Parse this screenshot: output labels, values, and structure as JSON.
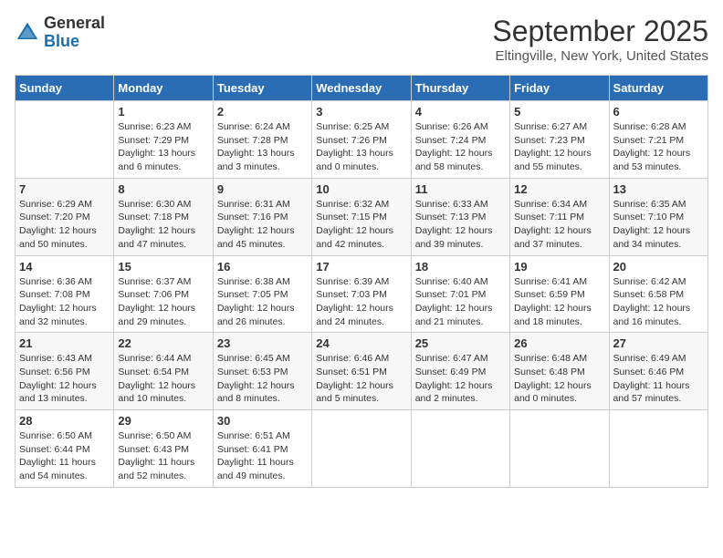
{
  "header": {
    "logo_general": "General",
    "logo_blue": "Blue",
    "month_title": "September 2025",
    "subtitle": "Eltingville, New York, United States"
  },
  "days_of_week": [
    "Sunday",
    "Monday",
    "Tuesday",
    "Wednesday",
    "Thursday",
    "Friday",
    "Saturday"
  ],
  "weeks": [
    [
      {
        "day": "",
        "text": ""
      },
      {
        "day": "1",
        "text": "Sunrise: 6:23 AM\nSunset: 7:29 PM\nDaylight: 13 hours\nand 6 minutes."
      },
      {
        "day": "2",
        "text": "Sunrise: 6:24 AM\nSunset: 7:28 PM\nDaylight: 13 hours\nand 3 minutes."
      },
      {
        "day": "3",
        "text": "Sunrise: 6:25 AM\nSunset: 7:26 PM\nDaylight: 13 hours\nand 0 minutes."
      },
      {
        "day": "4",
        "text": "Sunrise: 6:26 AM\nSunset: 7:24 PM\nDaylight: 12 hours\nand 58 minutes."
      },
      {
        "day": "5",
        "text": "Sunrise: 6:27 AM\nSunset: 7:23 PM\nDaylight: 12 hours\nand 55 minutes."
      },
      {
        "day": "6",
        "text": "Sunrise: 6:28 AM\nSunset: 7:21 PM\nDaylight: 12 hours\nand 53 minutes."
      }
    ],
    [
      {
        "day": "7",
        "text": "Sunrise: 6:29 AM\nSunset: 7:20 PM\nDaylight: 12 hours\nand 50 minutes."
      },
      {
        "day": "8",
        "text": "Sunrise: 6:30 AM\nSunset: 7:18 PM\nDaylight: 12 hours\nand 47 minutes."
      },
      {
        "day": "9",
        "text": "Sunrise: 6:31 AM\nSunset: 7:16 PM\nDaylight: 12 hours\nand 45 minutes."
      },
      {
        "day": "10",
        "text": "Sunrise: 6:32 AM\nSunset: 7:15 PM\nDaylight: 12 hours\nand 42 minutes."
      },
      {
        "day": "11",
        "text": "Sunrise: 6:33 AM\nSunset: 7:13 PM\nDaylight: 12 hours\nand 39 minutes."
      },
      {
        "day": "12",
        "text": "Sunrise: 6:34 AM\nSunset: 7:11 PM\nDaylight: 12 hours\nand 37 minutes."
      },
      {
        "day": "13",
        "text": "Sunrise: 6:35 AM\nSunset: 7:10 PM\nDaylight: 12 hours\nand 34 minutes."
      }
    ],
    [
      {
        "day": "14",
        "text": "Sunrise: 6:36 AM\nSunset: 7:08 PM\nDaylight: 12 hours\nand 32 minutes."
      },
      {
        "day": "15",
        "text": "Sunrise: 6:37 AM\nSunset: 7:06 PM\nDaylight: 12 hours\nand 29 minutes."
      },
      {
        "day": "16",
        "text": "Sunrise: 6:38 AM\nSunset: 7:05 PM\nDaylight: 12 hours\nand 26 minutes."
      },
      {
        "day": "17",
        "text": "Sunrise: 6:39 AM\nSunset: 7:03 PM\nDaylight: 12 hours\nand 24 minutes."
      },
      {
        "day": "18",
        "text": "Sunrise: 6:40 AM\nSunset: 7:01 PM\nDaylight: 12 hours\nand 21 minutes."
      },
      {
        "day": "19",
        "text": "Sunrise: 6:41 AM\nSunset: 6:59 PM\nDaylight: 12 hours\nand 18 minutes."
      },
      {
        "day": "20",
        "text": "Sunrise: 6:42 AM\nSunset: 6:58 PM\nDaylight: 12 hours\nand 16 minutes."
      }
    ],
    [
      {
        "day": "21",
        "text": "Sunrise: 6:43 AM\nSunset: 6:56 PM\nDaylight: 12 hours\nand 13 minutes."
      },
      {
        "day": "22",
        "text": "Sunrise: 6:44 AM\nSunset: 6:54 PM\nDaylight: 12 hours\nand 10 minutes."
      },
      {
        "day": "23",
        "text": "Sunrise: 6:45 AM\nSunset: 6:53 PM\nDaylight: 12 hours\nand 8 minutes."
      },
      {
        "day": "24",
        "text": "Sunrise: 6:46 AM\nSunset: 6:51 PM\nDaylight: 12 hours\nand 5 minutes."
      },
      {
        "day": "25",
        "text": "Sunrise: 6:47 AM\nSunset: 6:49 PM\nDaylight: 12 hours\nand 2 minutes."
      },
      {
        "day": "26",
        "text": "Sunrise: 6:48 AM\nSunset: 6:48 PM\nDaylight: 12 hours\nand 0 minutes."
      },
      {
        "day": "27",
        "text": "Sunrise: 6:49 AM\nSunset: 6:46 PM\nDaylight: 11 hours\nand 57 minutes."
      }
    ],
    [
      {
        "day": "28",
        "text": "Sunrise: 6:50 AM\nSunset: 6:44 PM\nDaylight: 11 hours\nand 54 minutes."
      },
      {
        "day": "29",
        "text": "Sunrise: 6:50 AM\nSunset: 6:43 PM\nDaylight: 11 hours\nand 52 minutes."
      },
      {
        "day": "30",
        "text": "Sunrise: 6:51 AM\nSunset: 6:41 PM\nDaylight: 11 hours\nand 49 minutes."
      },
      {
        "day": "",
        "text": ""
      },
      {
        "day": "",
        "text": ""
      },
      {
        "day": "",
        "text": ""
      },
      {
        "day": "",
        "text": ""
      }
    ]
  ]
}
